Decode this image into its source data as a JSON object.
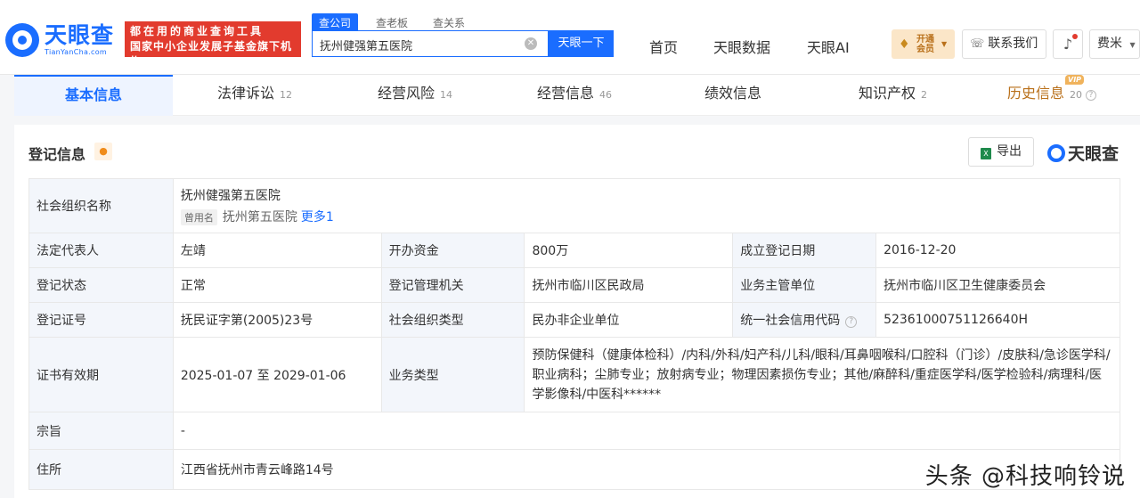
{
  "header": {
    "logo_cn": "天眼查",
    "logo_en": "TianYanCha.com",
    "banner_line1": "都在用的商业查询工具",
    "banner_line2": "国家中小企业发展子基金旗下机构",
    "search_tabs": [
      "查公司",
      "查老板",
      "查关系"
    ],
    "search_value": "抚州健强第五医院",
    "search_button": "天眼一下",
    "nav": [
      "首页",
      "天眼数据",
      "天眼AI"
    ],
    "vip_label": "开通会员",
    "contact_label": "联系我们",
    "user_label": "费米"
  },
  "tabs": [
    {
      "label": "基本信息",
      "count": ""
    },
    {
      "label": "法律诉讼",
      "count": "12"
    },
    {
      "label": "经营风险",
      "count": "14"
    },
    {
      "label": "经营信息",
      "count": "46"
    },
    {
      "label": "绩效信息",
      "count": ""
    },
    {
      "label": "知识产权",
      "count": "2"
    },
    {
      "label": "历史信息",
      "count": "20"
    }
  ],
  "vip_tag": "VIP",
  "section": {
    "title": "登记信息",
    "export_label": "导出",
    "brand": "天眼查"
  },
  "info": {
    "org_name_label": "社会组织名称",
    "org_name": "抚州健强第五医院",
    "used_name_tag": "曾用名",
    "used_name": "抚州第五医院",
    "more_label": "更多1",
    "legal_rep_label": "法定代表人",
    "legal_rep": "左靖",
    "capital_label": "开办资金",
    "capital": "800万",
    "reg_date_label": "成立登记日期",
    "reg_date": "2016-12-20",
    "status_label": "登记状态",
    "status": "正常",
    "authority_label": "登记管理机关",
    "authority": "抚州市临川区民政局",
    "supervisor_label": "业务主管单位",
    "supervisor": "抚州市临川区卫生健康委员会",
    "cert_no_label": "登记证号",
    "cert_no": "抚民证字第(2005)23号",
    "org_type_label": "社会组织类型",
    "org_type": "民办非企业单位",
    "credit_code_label": "统一社会信用代码",
    "credit_code": "52361000751126640H",
    "validity_label": "证书有效期",
    "validity": "2025-01-07 至 2029-01-06",
    "biz_type_label": "业务类型",
    "biz_type": "预防保健科（健康体检科）/内科/外科/妇产科/儿科/眼科/耳鼻咽喉科/口腔科（门诊）/皮肤科/急诊医学科/职业病科；尘肺专业；放射病专业；物理因素损伤专业；其他/麻醉科/重症医学科/医学检验科/病理科/医学影像科/中医科******",
    "purpose_label": "宗旨",
    "purpose": "-",
    "address_label": "住所",
    "address": "江西省抚州市青云峰路14号"
  },
  "watermark": "头条 @科技响铃说"
}
